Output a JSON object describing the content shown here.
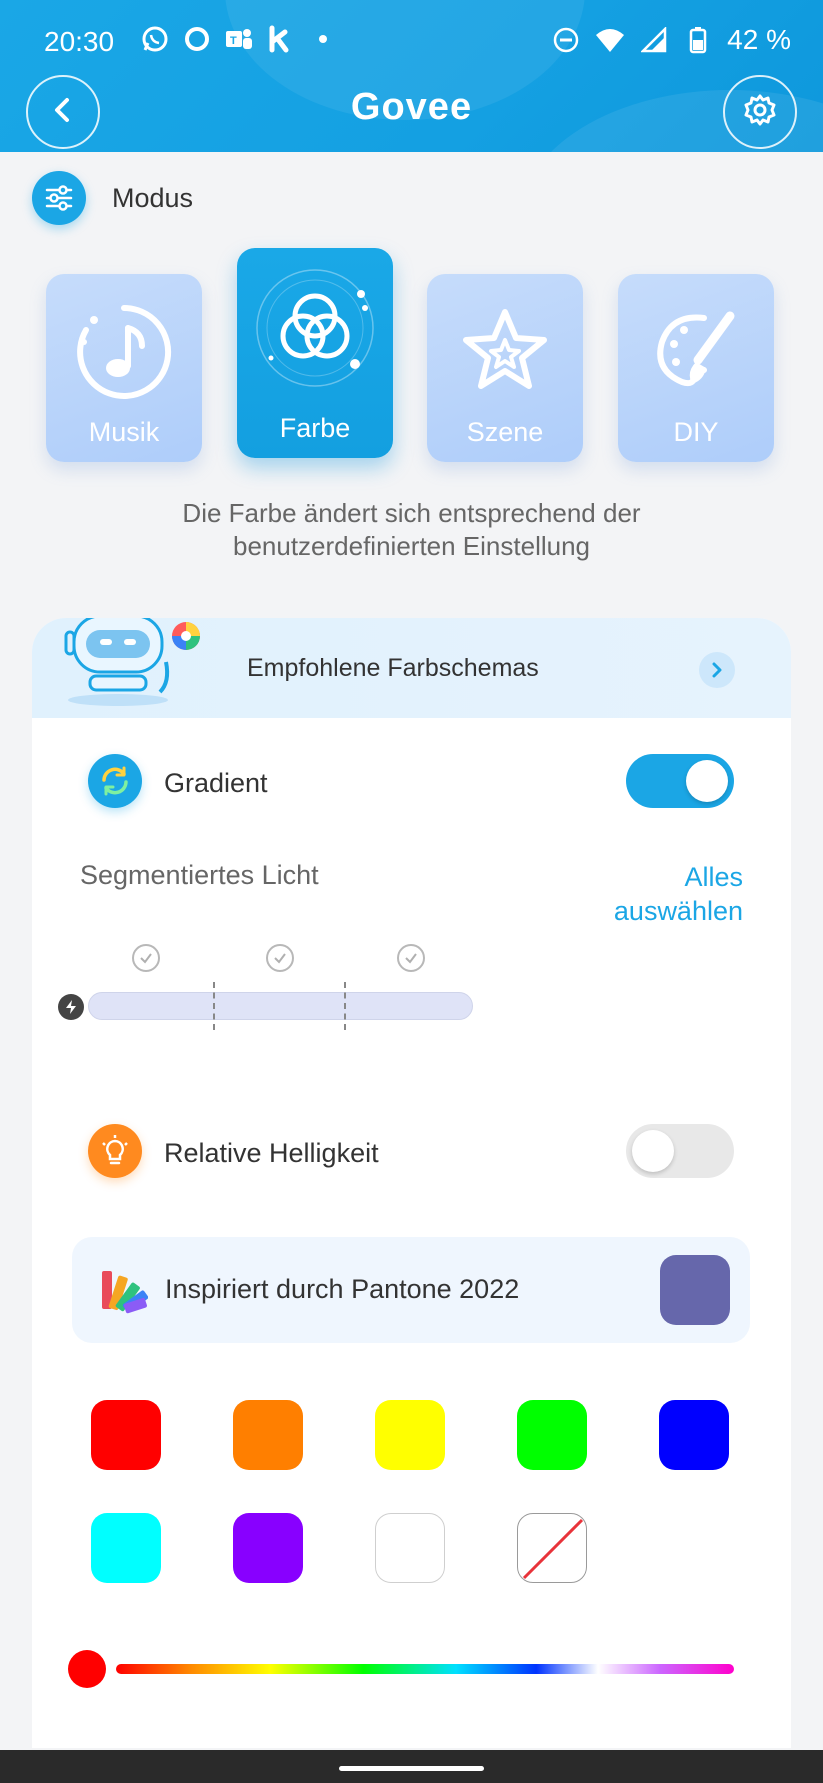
{
  "status": {
    "time": "20:30",
    "battery": "42 %",
    "left_icons": [
      "whatsapp-icon",
      "circle-app-icon",
      "teams-icon",
      "k-app-icon",
      "dot-icon"
    ],
    "right_icons": [
      "dnd-icon",
      "wifi-icon",
      "signal-icon",
      "battery-icon"
    ]
  },
  "header": {
    "brand": "Govee"
  },
  "modus": {
    "label": "Modus",
    "modes": [
      {
        "label": "Musik",
        "icon": "music-icon",
        "active": false
      },
      {
        "label": "Farbe",
        "icon": "color-circles-icon",
        "active": true
      },
      {
        "label": "Szene",
        "icon": "star-icon",
        "active": false
      },
      {
        "label": "DIY",
        "icon": "palette-icon",
        "active": false
      }
    ],
    "description": "Die Farbe ändert sich entsprechend der benutzerdefinierten Einstellung"
  },
  "recommend": {
    "label": "Empfohlene Farbschemas"
  },
  "gradient": {
    "label": "Gradient",
    "enabled": true
  },
  "segments": {
    "title": "Segmentiertes Licht",
    "select_all": "Alles auswählen",
    "count": 3
  },
  "brightness": {
    "label": "Relative Helligkeit",
    "enabled": false
  },
  "pantone": {
    "label": "Inspiriert durch Pantone 2022",
    "color": "#6667ab"
  },
  "swatches": [
    {
      "name": "red",
      "color": "#ff0000"
    },
    {
      "name": "orange",
      "color": "#ff7f00"
    },
    {
      "name": "yellow",
      "color": "#ffff00"
    },
    {
      "name": "green",
      "color": "#00ff00"
    },
    {
      "name": "blue",
      "color": "#0000ff"
    },
    {
      "name": "cyan",
      "color": "#00ffff"
    },
    {
      "name": "purple",
      "color": "#8800ff"
    },
    {
      "name": "white",
      "color": "#ffffff"
    },
    {
      "name": "none",
      "color": "none"
    }
  ],
  "hue_slider": {
    "value": 0,
    "thumb_color": "#ff0000"
  },
  "colors": {
    "accent": "#1ba6e5",
    "orange_icon": "#ff8a1f"
  }
}
